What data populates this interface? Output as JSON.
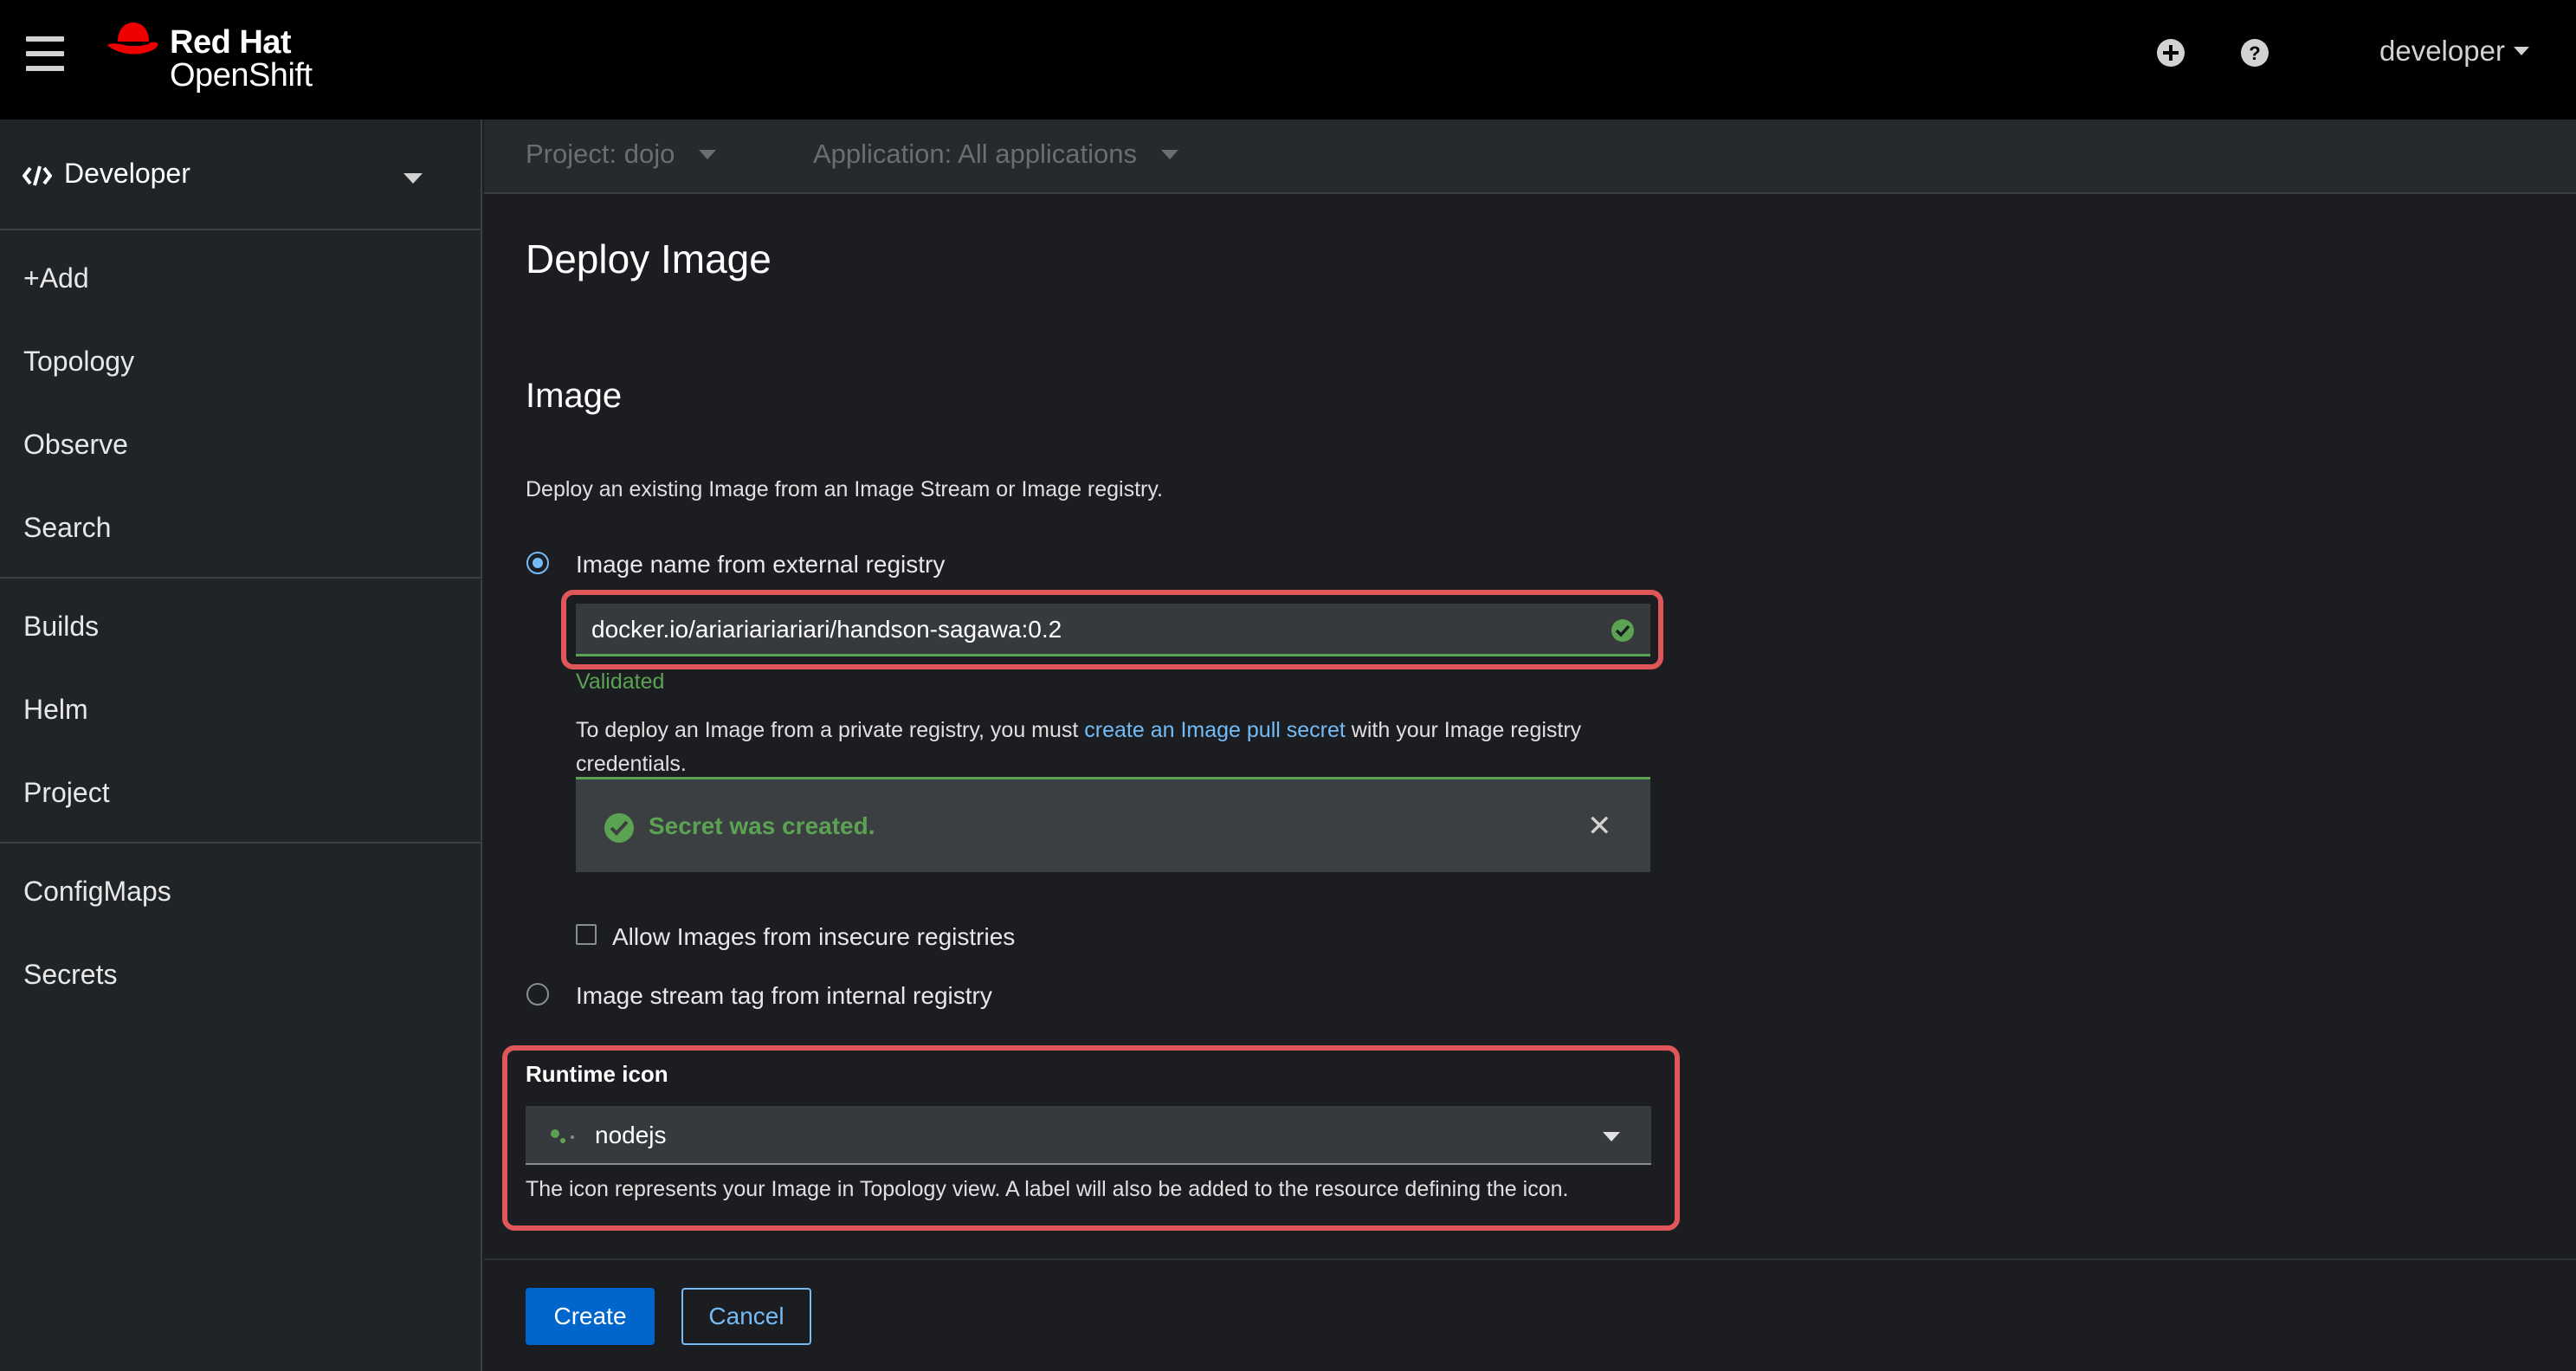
{
  "masthead": {
    "brand_line1": "Red Hat",
    "brand_line2": "OpenShift",
    "quick_create_icon": "plus-circle-icon",
    "help_icon": "question-circle-icon",
    "user": "developer"
  },
  "sidebar": {
    "perspective": "Developer",
    "groups": [
      [
        "+Add",
        "Topology",
        "Observe",
        "Search"
      ],
      [
        "Builds",
        "Helm",
        "Project"
      ],
      [
        "ConfigMaps",
        "Secrets"
      ]
    ]
  },
  "context_bar": {
    "project": "Project: dojo",
    "application": "Application: All applications"
  },
  "page": {
    "title": "Deploy Image",
    "section": "Image",
    "helper": "Deploy an existing Image from an Image Stream or Image registry.",
    "radio_external": "Image name from external registry",
    "image_name_value": "docker.io/ariariariariari/handson-sagawa:0.2",
    "validated": "Validated",
    "pull_text_before": "To deploy an Image from a private registry, you must ",
    "pull_link": "create an Image pull secret",
    "pull_text_after": " with your Image registry credentials.",
    "alert": "Secret was created.",
    "insecure_checkbox": "Allow Images from insecure registries",
    "radio_internal": "Image stream tag from internal registry",
    "runtime_label": "Runtime icon",
    "runtime_value": "nodejs",
    "runtime_helper": "The icon represents your Image in Topology view. A label will also be added to the resource defining the icon."
  },
  "actions": {
    "create": "Create",
    "cancel": "Cancel"
  },
  "colors": {
    "accent_blue": "#0066cc",
    "link_blue": "#73bcf7",
    "success_green": "#5ba352",
    "highlight_red": "#e0575a"
  }
}
